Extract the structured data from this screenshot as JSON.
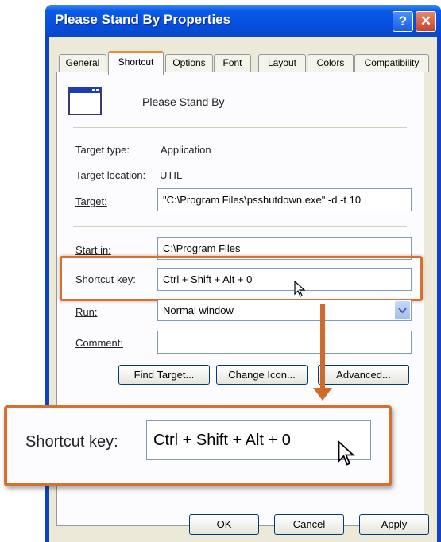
{
  "window": {
    "title": "Please Stand By Properties",
    "help_glyph": "?",
    "close_glyph": "✕"
  },
  "tabs": [
    "General",
    "Shortcut",
    "Options",
    "Font",
    "Layout",
    "Colors",
    "Compatibility"
  ],
  "active_tab": "Shortcut",
  "shortcut": {
    "name": "Please Stand By",
    "target_type_label": "Target type:",
    "target_type_value": "Application",
    "target_location_label": "Target location:",
    "target_location_value": "UTIL",
    "target_label": "Target:",
    "target_value": "\"C:\\Program Files\\psshutdown.exe\" -d -t 10",
    "start_in_label": "Start in:",
    "start_in_value": "C:\\Program Files",
    "shortcut_key_label": "Shortcut key:",
    "shortcut_key_value": "Ctrl + Shift + Alt + 0",
    "run_label": "Run:",
    "run_value": "Normal window",
    "comment_label": "Comment:",
    "comment_value": ""
  },
  "buttons": {
    "find_target": "Find Target...",
    "change_icon": "Change Icon...",
    "advanced": "Advanced...",
    "ok": "OK",
    "cancel": "Cancel",
    "apply": "Apply"
  },
  "callout": {
    "label": "Shortcut key:",
    "value": "Ctrl + Shift + Alt + 0"
  },
  "colors": {
    "titlebar": "#0a5ce8",
    "highlight": "#d6702c",
    "dialog_bg": "#ece9d8"
  },
  "icons": [
    "help-icon",
    "close-icon",
    "program-window-icon",
    "dropdown-arrow-icon",
    "mouse-cursor-icon"
  ]
}
